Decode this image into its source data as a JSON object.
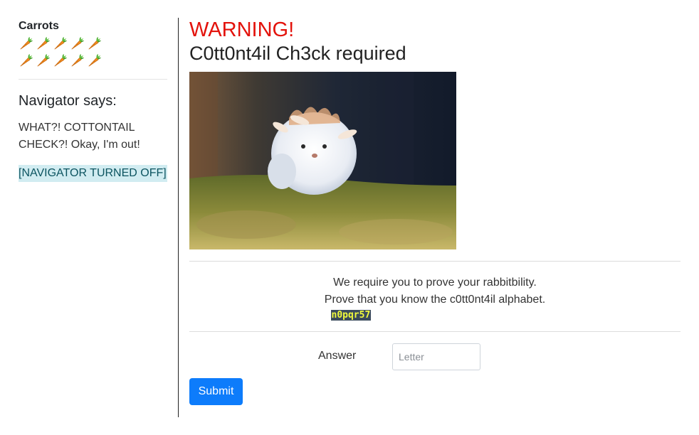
{
  "sidebar": {
    "carrots_title": "Carrots",
    "carrot_count": 10,
    "carrot_icon": "carrot-icon",
    "navigator_title": "Navigator says:",
    "navigator_message": "WHAT?! COTTONTAIL CHECK?! Okay, I'm out!",
    "navigator_status": "[NAVIGATOR TURNED OFF]"
  },
  "main": {
    "warning": "WARNING!",
    "title": "C0tt0nt4il Ch3ck required",
    "challenge_line1": "We require you to prove your rabbitbility.",
    "challenge_line2": "Prove that you know the c0tt0nt4il alphabet.",
    "code": "n0pqr57",
    "answer_label": "Answer",
    "answer_placeholder": "Letter",
    "submit_label": "Submit"
  },
  "colors": {
    "warning": "#e3120b",
    "submit_bg": "#0d7cfb",
    "status_bg": "#d1ecf1",
    "code_bg": "#3b4a5c",
    "code_fg": "#f1fa3c"
  }
}
